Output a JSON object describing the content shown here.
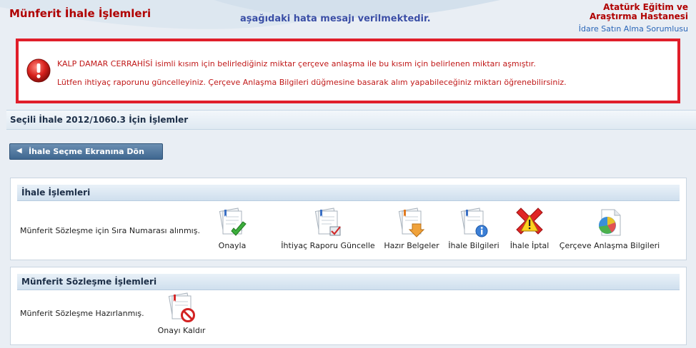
{
  "header": {
    "title": "Münferit İhale İşlemleri",
    "message": "aşağıdaki hata mesajı verilmektedir.",
    "hospital": "Atatürk Eğitim ve Araştırma Hastanesi",
    "role": "İdare Satın Alma Sorumlusu"
  },
  "error": {
    "line1": "KALP DAMAR CERRAHİSİ isimli kısım için belirlediğiniz miktar çerçeve anlaşma ile bu kısım için belirlenen miktarı aşmıştır.",
    "line2": "Lütfen ihtiyaç raporunu güncelleyiniz. Çerçeve Anlaşma Bilgileri düğmesine basarak alım yapabileceğiniz miktarı öğrenebilirsiniz."
  },
  "selected_bar": "Seçili İhale 2012/1060.3 İçin İşlemler",
  "back_button": "İhale Seçme Ekranına Dön",
  "panel1": {
    "title": "İhale İşlemleri",
    "status": "Münferit Sözleşme için Sıra Numarası alınmış.",
    "actions": [
      {
        "label": "Onayla",
        "icon": "approve-icon"
      },
      {
        "label": "İhtiyaç Raporu Güncelle",
        "icon": "update-report-icon"
      },
      {
        "label": "Hazır Belgeler",
        "icon": "documents-icon"
      },
      {
        "label": "İhale Bilgileri",
        "icon": "info-icon"
      },
      {
        "label": "İhale İptal",
        "icon": "cancel-icon"
      },
      {
        "label": "Çerçeve Anlaşma Bilgileri",
        "icon": "pie-chart-icon"
      }
    ]
  },
  "panel2": {
    "title": "Münferit Sözleşme İşlemleri",
    "status": "Münferit Sözleşme Hazırlanmış.",
    "actions": [
      {
        "label": "Onayı Kaldır",
        "icon": "remove-approval-icon"
      }
    ]
  }
}
